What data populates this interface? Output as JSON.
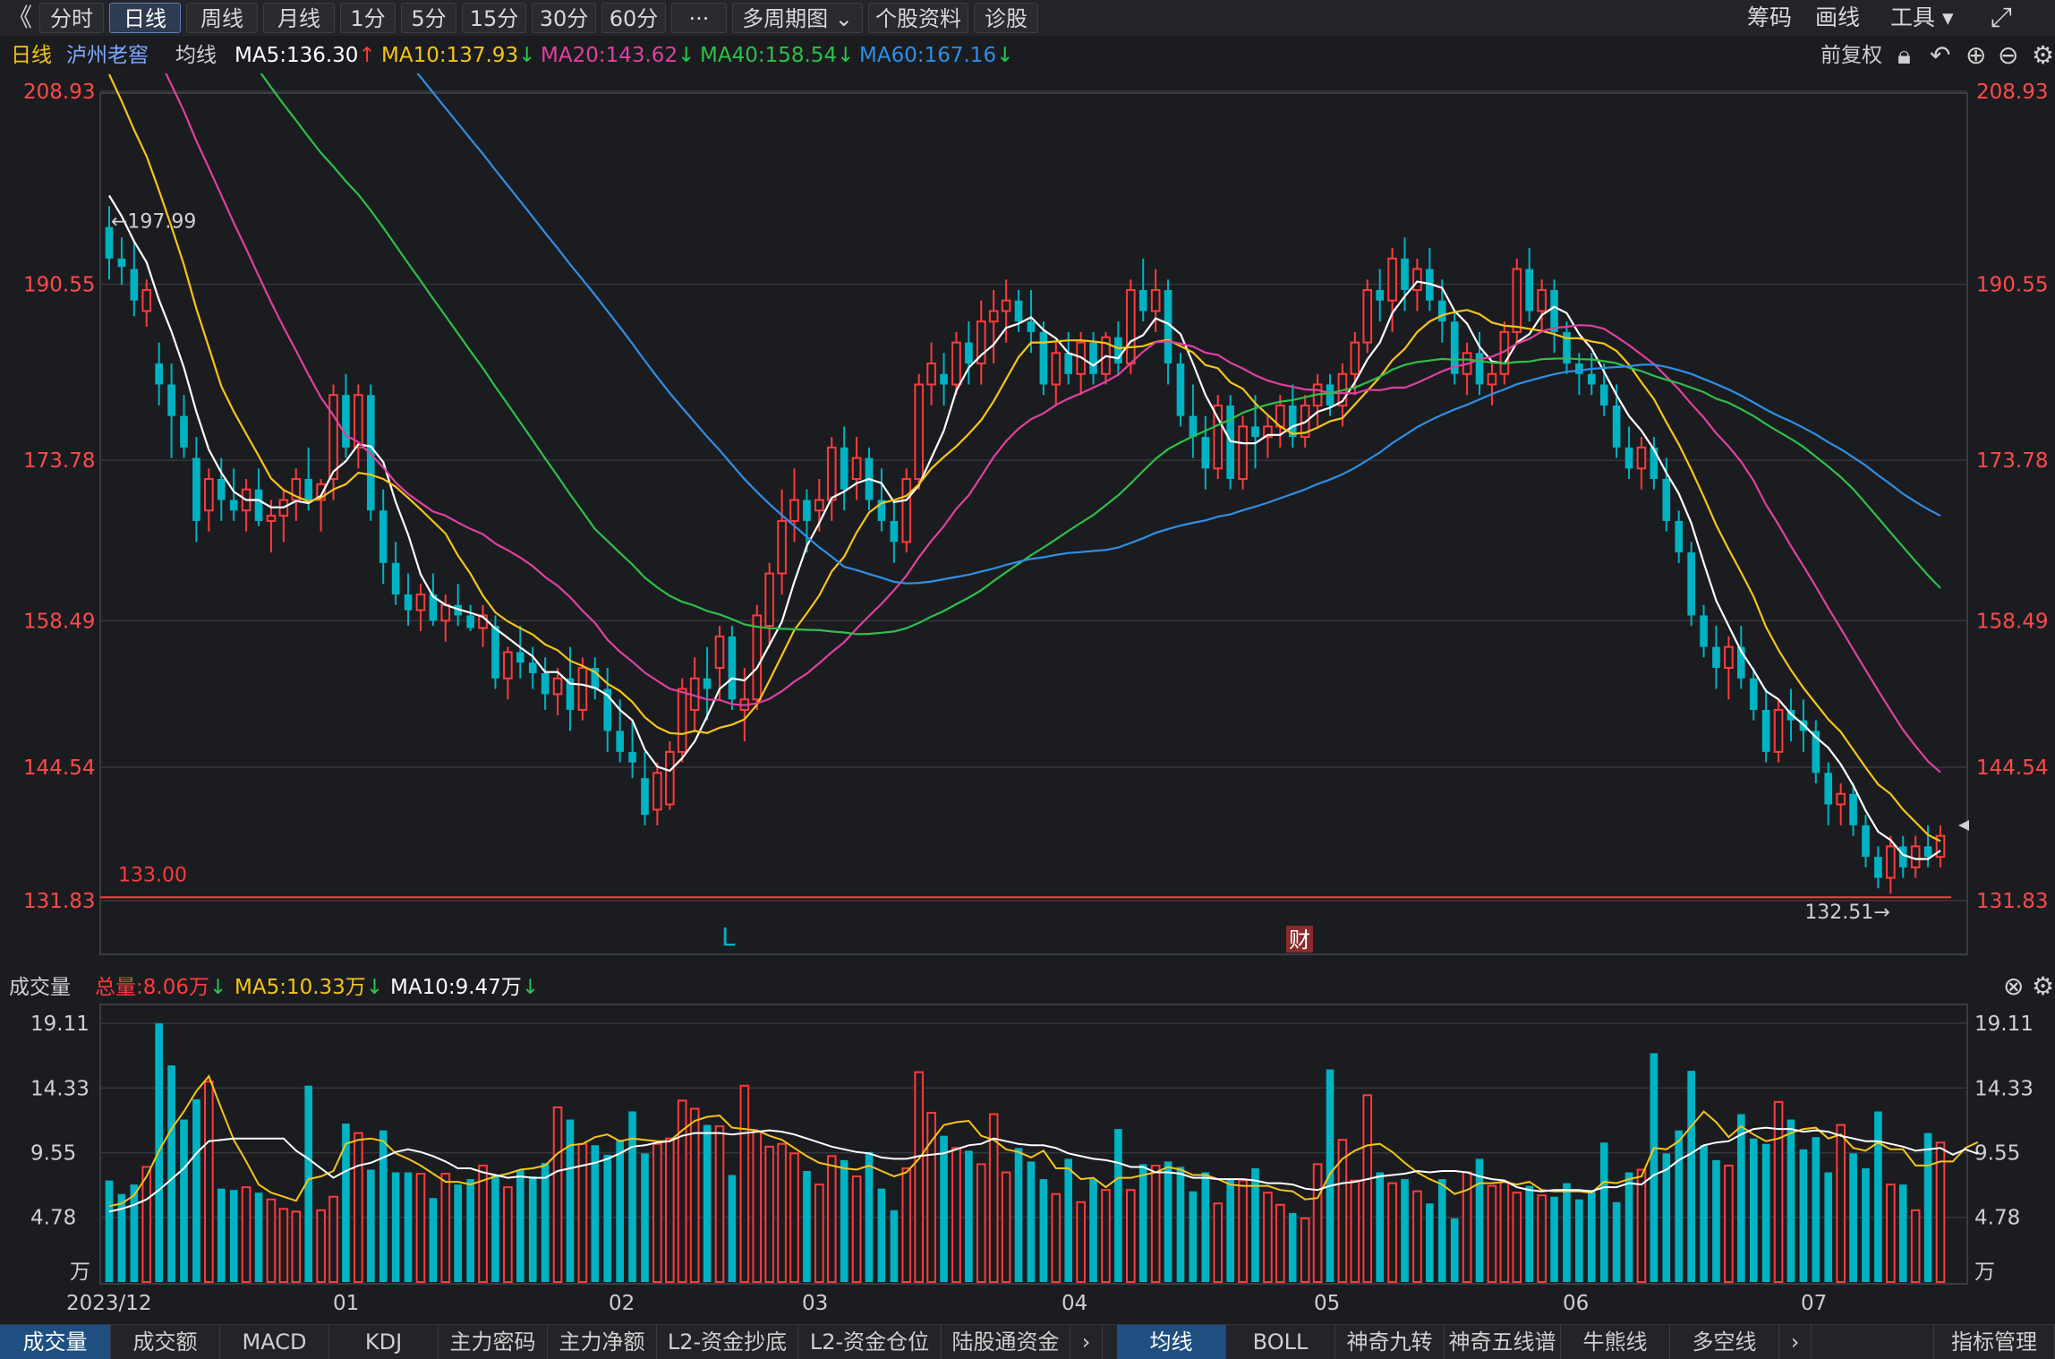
{
  "toolbar": {
    "back_icon": "double-left-chevron-icon",
    "tabs": [
      "分时",
      "日线",
      "周线",
      "月线",
      "1分",
      "5分",
      "15分",
      "30分",
      "60分",
      "···",
      "多周期图 ⌄",
      "个股资料",
      "诊股"
    ],
    "active_tab": "日线",
    "right": [
      "筹码",
      "画线",
      "工具 ▾"
    ],
    "fullscreen_icon": "fullscreen-icon"
  },
  "info": {
    "period": "日线",
    "stock_name": "泸州老窖",
    "indicator": "均线",
    "ma5": "MA5:136.30",
    "ma10": "MA10:137.93",
    "ma20": "MA20:143.62",
    "ma40": "MA40:158.54",
    "ma60": "MA60:167.16",
    "adjust": "前复权"
  },
  "colors": {
    "up": "#ff3b3b",
    "down": "#00b3c2",
    "ma5": "#ffffff",
    "ma10": "#f5c518",
    "ma20": "#e040a0",
    "ma40": "#2ec04a",
    "ma60": "#2f8fe6"
  },
  "volume_info": {
    "label": "成交量",
    "total": "总量:8.06万",
    "ma5": "MA5:10.33万",
    "ma10": "MA10:9.47万"
  },
  "x_labels": [
    "2023/12",
    "01",
    "02",
    "03",
    "04",
    "05",
    "06",
    "07"
  ],
  "chart_data": {
    "type": "candlestick",
    "price_ticks": [
      "208.93",
      "190.55",
      "173.78",
      "158.49",
      "144.54",
      "131.83"
    ],
    "volume_ticks": [
      "19.11",
      "14.33",
      "9.55",
      "4.78",
      "万"
    ],
    "annotations": {
      "high_label": "←197.99",
      "low_label": "132.51→",
      "support_line_label": "133.00",
      "marker_L": "L",
      "marker_fin": "财"
    },
    "candles": [
      {
        "o": 196,
        "h": 197.99,
        "l": 191,
        "c": 193
      },
      {
        "o": 193,
        "h": 195,
        "l": 190.5,
        "c": 192.2
      },
      {
        "o": 192,
        "h": 194.5,
        "l": 187.5,
        "c": 189
      },
      {
        "o": 188,
        "h": 191,
        "l": 186.5,
        "c": 190
      },
      {
        "o": 183,
        "h": 185,
        "l": 179,
        "c": 181
      },
      {
        "o": 181,
        "h": 183,
        "l": 174,
        "c": 178
      },
      {
        "o": 178,
        "h": 180,
        "l": 174,
        "c": 175
      },
      {
        "o": 174,
        "h": 176,
        "l": 166,
        "c": 168
      },
      {
        "o": 169,
        "h": 173,
        "l": 167,
        "c": 172
      },
      {
        "o": 172,
        "h": 174,
        "l": 168,
        "c": 170
      },
      {
        "o": 170,
        "h": 173,
        "l": 168,
        "c": 169
      },
      {
        "o": 169,
        "h": 172,
        "l": 167,
        "c": 171
      },
      {
        "o": 171,
        "h": 173,
        "l": 167.5,
        "c": 168
      },
      {
        "o": 168,
        "h": 170,
        "l": 165,
        "c": 168.5
      },
      {
        "o": 168.5,
        "h": 171,
        "l": 166,
        "c": 170
      },
      {
        "o": 170,
        "h": 173,
        "l": 168,
        "c": 172
      },
      {
        "o": 172,
        "h": 175,
        "l": 169,
        "c": 170
      },
      {
        "o": 170,
        "h": 172,
        "l": 167,
        "c": 171.5
      },
      {
        "o": 172,
        "h": 181,
        "l": 170,
        "c": 180
      },
      {
        "o": 180,
        "h": 182,
        "l": 174,
        "c": 175
      },
      {
        "o": 175,
        "h": 181,
        "l": 173,
        "c": 180
      },
      {
        "o": 180,
        "h": 181,
        "l": 168,
        "c": 169
      },
      {
        "o": 169,
        "h": 171,
        "l": 162,
        "c": 164
      },
      {
        "o": 164,
        "h": 166,
        "l": 160,
        "c": 161
      },
      {
        "o": 161,
        "h": 163,
        "l": 158,
        "c": 159.5
      },
      {
        "o": 159.5,
        "h": 162,
        "l": 157.5,
        "c": 161
      },
      {
        "o": 161,
        "h": 163,
        "l": 158,
        "c": 158.5
      },
      {
        "o": 158.5,
        "h": 161,
        "l": 156.5,
        "c": 160
      },
      {
        "o": 160,
        "h": 162,
        "l": 158,
        "c": 159
      },
      {
        "o": 159,
        "h": 160,
        "l": 157.5,
        "c": 157.8
      },
      {
        "o": 157.8,
        "h": 160,
        "l": 156,
        "c": 159
      },
      {
        "o": 158,
        "h": 159,
        "l": 152,
        "c": 153
      },
      {
        "o": 153,
        "h": 156,
        "l": 151,
        "c": 155.5
      },
      {
        "o": 155.5,
        "h": 158,
        "l": 153,
        "c": 154.5
      },
      {
        "o": 154.5,
        "h": 156,
        "l": 152,
        "c": 153.5
      },
      {
        "o": 153.5,
        "h": 155,
        "l": 150,
        "c": 151.5
      },
      {
        "o": 151.5,
        "h": 154,
        "l": 149.5,
        "c": 153
      },
      {
        "o": 153,
        "h": 156,
        "l": 148,
        "c": 150
      },
      {
        "o": 150,
        "h": 155,
        "l": 149,
        "c": 154
      },
      {
        "o": 154,
        "h": 155,
        "l": 151,
        "c": 152
      },
      {
        "o": 152,
        "h": 154,
        "l": 146,
        "c": 148
      },
      {
        "o": 148,
        "h": 151,
        "l": 145,
        "c": 146
      },
      {
        "o": 146,
        "h": 149,
        "l": 143.5,
        "c": 145
      },
      {
        "o": 143.5,
        "h": 146,
        "l": 139,
        "c": 140
      },
      {
        "o": 140.5,
        "h": 145,
        "l": 139,
        "c": 144
      },
      {
        "o": 141,
        "h": 147,
        "l": 140.5,
        "c": 146
      },
      {
        "o": 146,
        "h": 153,
        "l": 145,
        "c": 152
      },
      {
        "o": 150,
        "h": 155,
        "l": 148,
        "c": 153
      },
      {
        "o": 153,
        "h": 156,
        "l": 149,
        "c": 152
      },
      {
        "o": 154,
        "h": 158,
        "l": 151,
        "c": 157
      },
      {
        "o": 157,
        "h": 158,
        "l": 150,
        "c": 151
      },
      {
        "o": 150,
        "h": 154,
        "l": 147,
        "c": 151
      },
      {
        "o": 151,
        "h": 160,
        "l": 150,
        "c": 159
      },
      {
        "o": 158,
        "h": 164,
        "l": 156,
        "c": 163
      },
      {
        "o": 163,
        "h": 171,
        "l": 161,
        "c": 168
      },
      {
        "o": 168,
        "h": 173,
        "l": 166,
        "c": 170
      },
      {
        "o": 170,
        "h": 171,
        "l": 165,
        "c": 168
      },
      {
        "o": 169,
        "h": 172,
        "l": 167,
        "c": 170
      },
      {
        "o": 170,
        "h": 176,
        "l": 168,
        "c": 175
      },
      {
        "o": 175,
        "h": 177,
        "l": 169,
        "c": 171
      },
      {
        "o": 172,
        "h": 176,
        "l": 170,
        "c": 174
      },
      {
        "o": 174,
        "h": 175,
        "l": 169,
        "c": 170
      },
      {
        "o": 170,
        "h": 173,
        "l": 167,
        "c": 168
      },
      {
        "o": 168,
        "h": 170,
        "l": 164,
        "c": 166
      },
      {
        "o": 166,
        "h": 173,
        "l": 165,
        "c": 172
      },
      {
        "o": 172,
        "h": 182,
        "l": 171,
        "c": 181
      },
      {
        "o": 181,
        "h": 185,
        "l": 179,
        "c": 183
      },
      {
        "o": 182,
        "h": 184,
        "l": 179,
        "c": 181
      },
      {
        "o": 181,
        "h": 186,
        "l": 180,
        "c": 185
      },
      {
        "o": 185,
        "h": 187,
        "l": 181,
        "c": 183
      },
      {
        "o": 183,
        "h": 189,
        "l": 181,
        "c": 187
      },
      {
        "o": 187,
        "h": 190,
        "l": 183,
        "c": 188
      },
      {
        "o": 188,
        "h": 191,
        "l": 185,
        "c": 189
      },
      {
        "o": 189,
        "h": 190,
        "l": 186,
        "c": 187
      },
      {
        "o": 187,
        "h": 190,
        "l": 184,
        "c": 186
      },
      {
        "o": 186,
        "h": 187,
        "l": 180,
        "c": 181
      },
      {
        "o": 181,
        "h": 185,
        "l": 179,
        "c": 184
      },
      {
        "o": 184,
        "h": 186,
        "l": 181,
        "c": 182
      },
      {
        "o": 182,
        "h": 186,
        "l": 180,
        "c": 185
      },
      {
        "o": 185,
        "h": 186,
        "l": 181,
        "c": 182
      },
      {
        "o": 182,
        "h": 186,
        "l": 181,
        "c": 185.5
      },
      {
        "o": 185.5,
        "h": 187,
        "l": 182,
        "c": 183
      },
      {
        "o": 183,
        "h": 191,
        "l": 182,
        "c": 190
      },
      {
        "o": 190,
        "h": 193,
        "l": 187,
        "c": 188
      },
      {
        "o": 188,
        "h": 192,
        "l": 186,
        "c": 190
      },
      {
        "o": 190,
        "h": 191,
        "l": 181,
        "c": 183
      },
      {
        "o": 183,
        "h": 184,
        "l": 177,
        "c": 178
      },
      {
        "o": 178,
        "h": 181,
        "l": 174,
        "c": 176
      },
      {
        "o": 176,
        "h": 178,
        "l": 171,
        "c": 173
      },
      {
        "o": 173,
        "h": 180,
        "l": 172,
        "c": 179
      },
      {
        "o": 179,
        "h": 180,
        "l": 171,
        "c": 172
      },
      {
        "o": 172,
        "h": 178,
        "l": 171,
        "c": 177
      },
      {
        "o": 177,
        "h": 180,
        "l": 173,
        "c": 176
      },
      {
        "o": 176,
        "h": 178,
        "l": 174,
        "c": 177
      },
      {
        "o": 177,
        "h": 180,
        "l": 175,
        "c": 179
      },
      {
        "o": 179,
        "h": 181,
        "l": 175,
        "c": 176
      },
      {
        "o": 176,
        "h": 180,
        "l": 175,
        "c": 179
      },
      {
        "o": 179,
        "h": 182,
        "l": 177,
        "c": 181
      },
      {
        "o": 181,
        "h": 182,
        "l": 178,
        "c": 179
      },
      {
        "o": 179,
        "h": 183,
        "l": 177,
        "c": 182
      },
      {
        "o": 182,
        "h": 186,
        "l": 180,
        "c": 185
      },
      {
        "o": 185,
        "h": 191,
        "l": 184,
        "c": 190
      },
      {
        "o": 190,
        "h": 192,
        "l": 187,
        "c": 189
      },
      {
        "o": 189,
        "h": 194,
        "l": 186,
        "c": 193
      },
      {
        "o": 193,
        "h": 195,
        "l": 188,
        "c": 190
      },
      {
        "o": 190,
        "h": 193,
        "l": 188,
        "c": 192
      },
      {
        "o": 192,
        "h": 194,
        "l": 188,
        "c": 189
      },
      {
        "o": 189,
        "h": 191,
        "l": 185,
        "c": 187
      },
      {
        "o": 187,
        "h": 188,
        "l": 181,
        "c": 182
      },
      {
        "o": 182,
        "h": 185,
        "l": 180,
        "c": 184
      },
      {
        "o": 184,
        "h": 186,
        "l": 180,
        "c": 181
      },
      {
        "o": 181,
        "h": 183,
        "l": 179,
        "c": 182
      },
      {
        "o": 182,
        "h": 187,
        "l": 181,
        "c": 186
      },
      {
        "o": 186,
        "h": 193,
        "l": 185,
        "c": 192
      },
      {
        "o": 192,
        "h": 194,
        "l": 187,
        "c": 188
      },
      {
        "o": 188,
        "h": 191,
        "l": 186,
        "c": 190
      },
      {
        "o": 190,
        "h": 191,
        "l": 184,
        "c": 186
      },
      {
        "o": 186,
        "h": 187,
        "l": 182,
        "c": 183
      },
      {
        "o": 183,
        "h": 184,
        "l": 180,
        "c": 182
      },
      {
        "o": 182,
        "h": 184,
        "l": 180,
        "c": 181
      },
      {
        "o": 181,
        "h": 183,
        "l": 178,
        "c": 179
      },
      {
        "o": 179,
        "h": 181,
        "l": 174,
        "c": 175
      },
      {
        "o": 175,
        "h": 177,
        "l": 172,
        "c": 173
      },
      {
        "o": 173,
        "h": 176,
        "l": 171,
        "c": 175
      },
      {
        "o": 175,
        "h": 176,
        "l": 171,
        "c": 172
      },
      {
        "o": 172,
        "h": 174,
        "l": 167,
        "c": 168
      },
      {
        "o": 168,
        "h": 169,
        "l": 164,
        "c": 165
      },
      {
        "o": 165,
        "h": 166,
        "l": 158,
        "c": 159
      },
      {
        "o": 159,
        "h": 160,
        "l": 155,
        "c": 156
      },
      {
        "o": 156,
        "h": 158,
        "l": 152,
        "c": 154
      },
      {
        "o": 154,
        "h": 157,
        "l": 151,
        "c": 156
      },
      {
        "o": 156,
        "h": 158,
        "l": 152,
        "c": 153
      },
      {
        "o": 153,
        "h": 154,
        "l": 149,
        "c": 150
      },
      {
        "o": 150,
        "h": 152,
        "l": 145,
        "c": 146
      },
      {
        "o": 146,
        "h": 151,
        "l": 145,
        "c": 150
      },
      {
        "o": 150,
        "h": 152,
        "l": 147,
        "c": 149
      },
      {
        "o": 149,
        "h": 151,
        "l": 146,
        "c": 148
      },
      {
        "o": 148,
        "h": 149,
        "l": 143,
        "c": 144
      },
      {
        "o": 144,
        "h": 145,
        "l": 139,
        "c": 141
      },
      {
        "o": 141,
        "h": 143,
        "l": 139,
        "c": 142
      },
      {
        "o": 142,
        "h": 143,
        "l": 138,
        "c": 139
      },
      {
        "o": 139,
        "h": 140,
        "l": 135,
        "c": 136
      },
      {
        "o": 136,
        "h": 137,
        "l": 133,
        "c": 134
      },
      {
        "o": 134,
        "h": 138,
        "l": 132.51,
        "c": 137
      },
      {
        "o": 137,
        "h": 138,
        "l": 134,
        "c": 135
      },
      {
        "o": 135,
        "h": 138,
        "l": 134,
        "c": 137
      },
      {
        "o": 137,
        "h": 139,
        "l": 135,
        "c": 136
      },
      {
        "o": 136,
        "h": 139,
        "l": 135,
        "c": 138
      }
    ],
    "volumes": [
      7.5,
      6.5,
      7.2,
      8.5,
      19.1,
      16,
      12,
      13.5,
      14.8,
      6.9,
      6.8,
      7,
      6.6,
      6.1,
      5.4,
      5.2,
      14.5,
      5.3,
      6.3,
      11.7,
      11,
      8.3,
      11.2,
      8.1,
      8.1,
      8,
      6.2,
      8,
      7.2,
      7.6,
      8.6,
      7.9,
      7,
      8.3,
      7.8,
      8.8,
      12.9,
      12,
      10.2,
      10.1,
      9.4,
      10.5,
      12.6,
      9.5,
      10.2,
      10.6,
      13.4,
      12.8,
      11.6,
      11.5,
      7.9,
      14.5,
      11.1,
      10,
      10.2,
      9.5,
      8.2,
      7.2,
      9.3,
      9,
      7.8,
      9.6,
      6.9,
      5.3,
      8.4,
      15.5,
      12.5,
      10.8,
      9.9,
      9.7,
      8.7,
      12.4,
      8.1,
      9.9,
      8.9,
      7.6,
      6.5,
      9.1,
      5.9,
      7.6,
      6.8,
      11.3,
      6.8,
      8.7,
      8.6,
      8.9,
      8.5,
      6.7,
      8.1,
      5.8,
      7.6,
      7.5,
      8.4,
      6.6,
      5.7,
      5.1,
      4.7,
      8.7,
      15.7,
      10.5,
      7.5,
      13.8,
      8.1,
      7.3,
      7.6,
      6.7,
      5.8,
      7.6,
      4.7,
      8.1,
      9.1,
      7.1,
      7.4,
      6.6,
      7.1,
      6.4,
      6.3,
      7.3,
      6.1,
      6.8,
      10.3,
      5.9,
      8.1,
      8.3,
      16.9,
      9.5,
      11.2,
      15.6,
      10.1,
      9,
      8.6,
      12.4,
      10.6,
      10.2,
      13.3,
      12,
      9.8,
      10.7,
      8.1,
      11.6,
      9.5,
      8.4,
      12.6,
      7.2,
      7.2,
      5.3,
      11,
      10.3,
      9.7,
      11.3,
      8.06
    ],
    "vol_ma5": [
      5.6,
      5.8,
      6.4,
      7.8,
      9.7,
      11.3,
      12.6,
      14.1,
      15.2,
      12.8,
      10.5,
      8.9,
      7.2,
      6.6,
      6.3,
      6,
      7.6,
      7.8,
      8.2,
      10.2,
      10.5,
      10.6,
      10.4,
      9.5,
      9.1,
      8.6,
      8,
      7.4,
      7.4,
      7.2,
      7.5,
      7.8,
      8,
      8.3,
      8.4,
      8.6,
      9.5,
      10.1,
      10.2,
      10.7,
      10.9,
      10.4,
      10.6,
      10.5,
      10.4,
      10.4,
      11.2,
      11.9,
      12.2,
      12.3,
      11.4,
      11.3,
      11.2,
      10.8,
      10.5,
      9.9,
      9.3,
      8.8,
      8.6,
      8.4,
      8.3,
      8.6,
      8.2,
      7.8,
      8.1,
      9.1,
      10.4,
      11.6,
      11.8,
      11.9,
      10.8,
      10.5,
      9.8,
      9.6,
      9.2,
      9.7,
      8.4,
      8.4,
      7.6,
      7.7,
      7,
      7.7,
      7.7,
      7.9,
      8.1,
      8.5,
      8.3,
      7.9,
      7.9,
      7.6,
      7.2,
      7.1,
      7.1,
      7.1,
      6.8,
      6.7,
      6.1,
      6.2,
      8,
      9.1,
      9.7,
      10.1,
      10.2,
      9.6,
      8.8,
      8.1,
      7.6,
      7.2,
      6.5,
      6.8,
      7.3,
      7.3,
      7.4,
      7.2,
      7.4,
      6.8,
      6.7,
      6.7,
      6.7,
      6.6,
      7.4,
      7.3,
      7.6,
      7.8,
      9.9,
      9.8,
      10.4,
      11.5,
      12.6,
      11.8,
      10.7,
      11.5,
      10.9,
      10.4,
      10.6,
      11,
      11.3,
      11.4,
      10.6,
      10.9,
      9.9,
      9.7,
      10.3,
      9.8,
      9.8,
      8.6,
      8.6,
      8.9,
      8.9,
      9.9,
      10.33
    ],
    "vol_ma10": [
      5.2,
      5.4,
      5.7,
      6.1,
      6.8,
      7.6,
      8.4,
      9.5,
      10.4,
      10.5,
      10.6,
      10.6,
      10.6,
      10.6,
      10.6,
      9.7,
      9.1,
      8.4,
      7.7,
      8.2,
      8.6,
      8.8,
      9.2,
      9.6,
      9.8,
      9.6,
      9.3,
      8.9,
      8.4,
      8.4,
      8.1,
      7.9,
      7.7,
      7.8,
      7.7,
      7.7,
      8.2,
      8.4,
      8.6,
      8.8,
      9.1,
      9.5,
      10,
      10.1,
      10.3,
      10.4,
      10.8,
      11,
      11,
      11,
      10.9,
      11,
      11.1,
      11.2,
      11.1,
      10.9,
      10.6,
      10.3,
      10,
      9.8,
      9.6,
      9.5,
      9.2,
      9.1,
      9.1,
      9.3,
      9.4,
      9.5,
      9.8,
      10.1,
      10.2,
      10.6,
      10.4,
      10.2,
      10.1,
      10.1,
      9.9,
      9.5,
      9.3,
      9.1,
      9,
      8.8,
      8.5,
      8.5,
      8.1,
      8.1,
      8,
      7.7,
      7.7,
      7.6,
      7.6,
      7.6,
      7.5,
      7.3,
      7.3,
      7.2,
      6.9,
      6.8,
      7.1,
      7.3,
      7.4,
      7.6,
      7.8,
      7.9,
      8,
      8.2,
      8.1,
      8.2,
      8.2,
      8.1,
      7.8,
      7.6,
      7.5,
      7,
      6.8,
      6.7,
      6.8,
      6.8,
      6.8,
      6.7,
      7,
      7,
      7.3,
      7.2,
      7.9,
      8.3,
      9,
      9.5,
      10.1,
      10.3,
      10.4,
      10.9,
      11.3,
      11.4,
      11.3,
      11.3,
      11.1,
      11.2,
      11.1,
      10.8,
      10.6,
      10.4,
      10.4,
      10.2,
      10,
      9.7,
      9.8,
      9.9,
      9.4,
      9.8,
      9.47
    ]
  }
}
